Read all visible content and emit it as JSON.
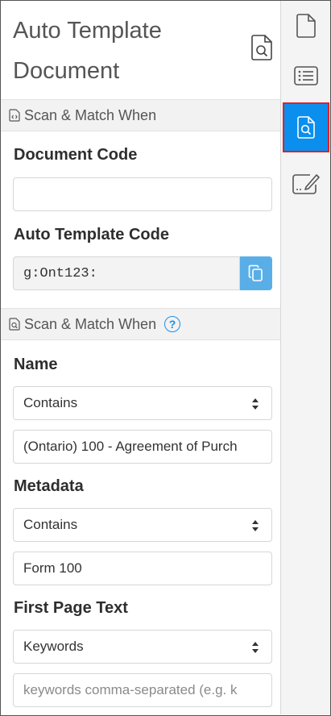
{
  "panel": {
    "title_line1": "Auto Template",
    "title_line2": "Document",
    "title_icon": "document-search-icon"
  },
  "section1": {
    "icon": "document-code-icon",
    "label": "Scan & Match When"
  },
  "document_code": {
    "label": "Document Code",
    "value": ""
  },
  "auto_template_code": {
    "label": "Auto Template Code",
    "value": "g:Ont123:",
    "copy_icon": "copy-icon"
  },
  "section2": {
    "icon": "document-search-icon",
    "label": "Scan & Match When",
    "help": "?"
  },
  "name": {
    "label": "Name",
    "operator": "Contains",
    "value": "(Ontario) 100 - Agreement of Purch"
  },
  "metadata": {
    "label": "Metadata",
    "operator": "Contains",
    "value": "Form 100"
  },
  "first_page_text": {
    "label": "First Page Text",
    "operator": "Keywords",
    "placeholder": "keywords comma-separated (e.g. k"
  },
  "rail": {
    "items": [
      {
        "icon": "document-icon",
        "active": false
      },
      {
        "icon": "list-icon",
        "active": false
      },
      {
        "icon": "document-search-icon",
        "active": true
      },
      {
        "icon": "signature-icon",
        "active": false
      }
    ]
  },
  "colors": {
    "accent": "#0a8fee",
    "copy_button": "#5aaee8",
    "highlight_border": "#e0202a",
    "section_bg": "#f2f2f2"
  }
}
